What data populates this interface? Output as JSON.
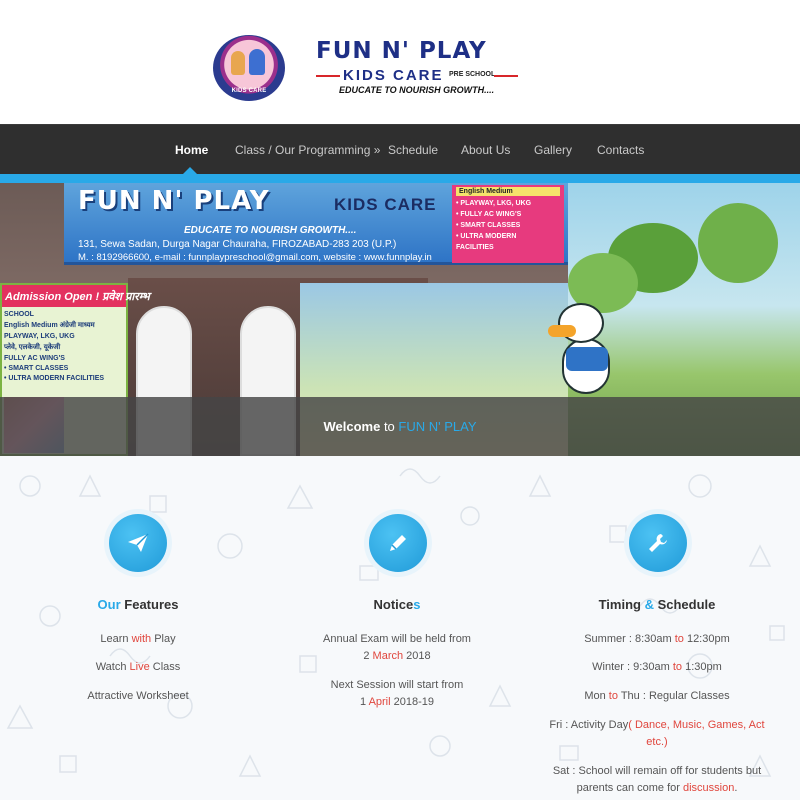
{
  "logo": {
    "badge_text": "KIDS CARE",
    "title": "FUN N' PLAY",
    "kids_care": "KIDS CARE",
    "pre_school": "PRE SCHOOL",
    "tagline": "EDUCATE TO NOURISH GROWTH...."
  },
  "nav": {
    "items": [
      {
        "label": "Home"
      },
      {
        "label": "Class / Our Programming »"
      },
      {
        "label": "Schedule"
      },
      {
        "label": "About Us"
      },
      {
        "label": "Gallery"
      },
      {
        "label": "Contacts"
      }
    ],
    "accent_color": "#29a9e8"
  },
  "hero": {
    "sign_title": "FUN N' PLAY",
    "sign_kids": "KIDS CARE",
    "sign_tagline": "EDUCATE TO NOURISH GROWTH....",
    "sign_address": "131, Sewa Sadan, Durga Nagar Chauraha, FIROZABAD-283 203 (U.P.)",
    "sign_contact": "M. : 8192966600, e-mail : funnplaypreschool@gmail.com, website : www.funnplay.in",
    "sign_list": [
      "English Medium",
      "• PLAYWAY, LKG, UKG",
      "• FULLY AC WING'S",
      "• SMART CLASSES",
      "• ULTRA MODERN",
      "FACILITIES"
    ],
    "admission": "Admission Open ! प्रवेश प्रारम्भ",
    "board_lines": [
      "SCHOOL",
      "English Medium  अंग्रेजी माध्यम",
      "PLAYWAY, LKG, UKG",
      "प्लेवे, एलकेजी, यूकेजी",
      "FULLY AC WING'S",
      "• SMART CLASSES",
      "• ULTRA MODERN FACILITIES"
    ],
    "caption_bold": "Welcome",
    "caption_to": " to ",
    "caption_name": "FUN N' PLAY"
  },
  "features": {
    "col1": {
      "icon": "paper-plane-icon",
      "title_a": "Our",
      "title_b": " Features",
      "lines": [
        {
          "a": "Learn ",
          "b": "with",
          "c": " Play"
        },
        {
          "a": "Watch ",
          "b": "Live",
          "c": " Class"
        },
        {
          "a": "Attractive Worksheet",
          "b": "",
          "c": ""
        }
      ]
    },
    "col2": {
      "icon": "pencil-icon",
      "title_a": "Notice",
      "title_b": "s",
      "lines": [
        {
          "a": "Annual Exam will be held from",
          "b": "",
          "c": ""
        },
        {
          "a": "2 ",
          "b": "March",
          "c": " 2018"
        },
        {
          "a": "Next Session will start from",
          "b": "",
          "c": ""
        },
        {
          "a": "1 ",
          "b": "April",
          "c": " 2018-19"
        }
      ]
    },
    "col3": {
      "icon": "wrench-icon",
      "title_a": "Timing ",
      "title_amp": "&",
      "title_b": " Schedule",
      "lines": [
        {
          "a": "Summer   :  8:30am ",
          "b": "to",
          "c": " 12:30pm",
          "d": ""
        },
        {
          "a": "Winter   : 9:30am ",
          "b": "to",
          "c": " 1:30pm",
          "d": ""
        },
        {
          "a": "Mon ",
          "b": "to",
          "c": " Thu   : Regular Classes",
          "d": ""
        },
        {
          "a": "Fri   : Activity Day",
          "b": "( Dance, Music, Games, Act",
          "c": "",
          "d": ""
        },
        {
          "a": "",
          "b": "etc.)",
          "c": "",
          "d": ""
        },
        {
          "a": "Sat   : School will remain off for students but",
          "b": "",
          "c": "",
          "d": ""
        },
        {
          "a": "parents can come for ",
          "b": "discussion",
          "c": ".",
          "d": ""
        }
      ]
    }
  }
}
